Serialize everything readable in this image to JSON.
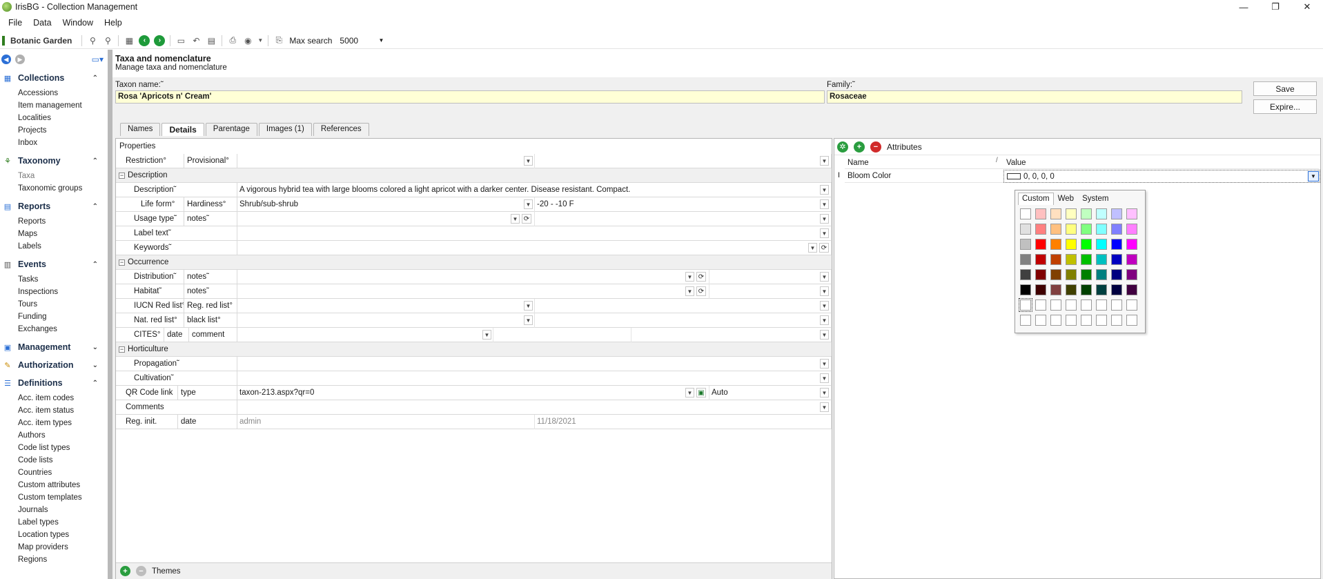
{
  "window": {
    "title": "IrisBG - Collection Management",
    "min": "—",
    "max": "❐",
    "close": "✕"
  },
  "menu": [
    "File",
    "Data",
    "Window",
    "Help"
  ],
  "toolbar": {
    "brand": "Botanic Garden",
    "max_search_label": "Max search",
    "max_search_value": "5000"
  },
  "sidebar": {
    "sections": [
      {
        "name": "Collections",
        "expanded": true,
        "icon": "collections-icon",
        "items": [
          "Accessions",
          "Item management",
          "Localities",
          "Projects",
          "Inbox"
        ]
      },
      {
        "name": "Taxonomy",
        "expanded": true,
        "icon": "taxonomy-icon",
        "items": [
          "Taxa",
          "Taxonomic groups"
        ]
      },
      {
        "name": "Reports",
        "expanded": true,
        "icon": "reports-icon",
        "items": [
          "Reports",
          "Maps",
          "Labels"
        ]
      },
      {
        "name": "Events",
        "expanded": true,
        "icon": "events-icon",
        "items": [
          "Tasks",
          "Inspections",
          "Tours",
          "Funding",
          "Exchanges"
        ]
      },
      {
        "name": "Management",
        "expanded": false,
        "icon": "management-icon",
        "items": []
      },
      {
        "name": "Authorization",
        "expanded": false,
        "icon": "authorization-icon",
        "items": []
      },
      {
        "name": "Definitions",
        "expanded": true,
        "icon": "definitions-icon",
        "items": [
          "Acc. item codes",
          "Acc. item status",
          "Acc. item types",
          "Authors",
          "Code list types",
          "Code lists",
          "Countries",
          "Custom attributes",
          "Custom templates",
          "Journals",
          "Label types",
          "Location types",
          "Map providers",
          "Regions"
        ]
      }
    ]
  },
  "page": {
    "title": "Taxa and nomenclature",
    "subtitle": "Manage taxa and nomenclature"
  },
  "form": {
    "taxon_label": "Taxon name:˜",
    "taxon_value": "Rosa 'Apricots n' Cream'",
    "family_label": "Family:˜",
    "family_value": "Rosaceae",
    "save": "Save",
    "expire": "Expire..."
  },
  "tabs": [
    "Names",
    "Details",
    "Parentage",
    "Images (1)",
    "References"
  ],
  "properties": {
    "caption": "Properties",
    "restriction_label": "Restriction°",
    "provisional_label": "Provisional°",
    "group_description": "Description",
    "description_label": "Description˜",
    "description_value": "A vigorous hybrid tea with large blooms colored a light apricot with a darker center. Disease resistant. Compact.",
    "lifeform_label": "Life form°",
    "hardiness_label": "Hardiness°",
    "lifeform_value": "Shrub/sub-shrub",
    "hardiness_value": "-20 - -10 F",
    "usage_label": "Usage type˜",
    "notes_label": "notes˜",
    "labeltext_label": "Label text˜",
    "keywords_label": "Keywords˜",
    "group_occurrence": "Occurrence",
    "distribution_label": "Distribution˜",
    "habitat_label": "Habitat˜",
    "iucn_label": "IUCN Red list°",
    "regred_label": "Reg. red list°",
    "natred_label": "Nat. red list°",
    "blacklist_label": "black list°",
    "cites_label": "CITES°",
    "date_label": "date",
    "comment_label": "comment",
    "group_horticulture": "Horticulture",
    "propagation_label": "Propagation˜",
    "cultivation_label": "Cultivation˜",
    "qr_label": "QR Code link",
    "type_label": "type",
    "qr_value": "taxon-213.aspx?qr=0",
    "qr_mode": "Auto",
    "comments_label": "Comments",
    "reginit_label": "Reg. init.",
    "reginit_value": "admin",
    "reginit_date": "11/18/2021"
  },
  "themes": {
    "label": "Themes"
  },
  "attributes": {
    "caption": "Attributes",
    "col_name": "Name",
    "col_value": "Value",
    "row_name": "Bloom Color",
    "row_value": "0, 0, 0, 0"
  },
  "color_picker": {
    "tabs": [
      "Custom",
      "Web",
      "System"
    ],
    "active_tab": "Custom",
    "rows": [
      [
        "#ffffff",
        "#ffc0c0",
        "#ffe0c0",
        "#ffffc0",
        "#c0ffc0",
        "#c0ffff",
        "#c0c0ff",
        "#ffc0ff"
      ],
      [
        "#e0e0e0",
        "#ff8080",
        "#ffc080",
        "#ffff80",
        "#80ff80",
        "#80ffff",
        "#8080ff",
        "#ff80ff"
      ],
      [
        "#c0c0c0",
        "#ff0000",
        "#ff8000",
        "#ffff00",
        "#00ff00",
        "#00ffff",
        "#0000ff",
        "#ff00ff"
      ],
      [
        "#808080",
        "#c00000",
        "#c04000",
        "#c0c000",
        "#00c000",
        "#00c0c0",
        "#0000c0",
        "#c000c0"
      ],
      [
        "#404040",
        "#800000",
        "#804000",
        "#808000",
        "#008000",
        "#008080",
        "#000080",
        "#800080"
      ],
      [
        "#000000",
        "#400000",
        "#804040",
        "#404000",
        "#004000",
        "#004040",
        "#000040",
        "#400040"
      ],
      [
        "#ffffff",
        "#ffffff",
        "#ffffff",
        "#ffffff",
        "#ffffff",
        "#ffffff",
        "#ffffff",
        "#ffffff"
      ],
      [
        "#ffffff",
        "#ffffff",
        "#ffffff",
        "#ffffff",
        "#ffffff",
        "#ffffff",
        "#ffffff",
        "#ffffff"
      ]
    ]
  }
}
